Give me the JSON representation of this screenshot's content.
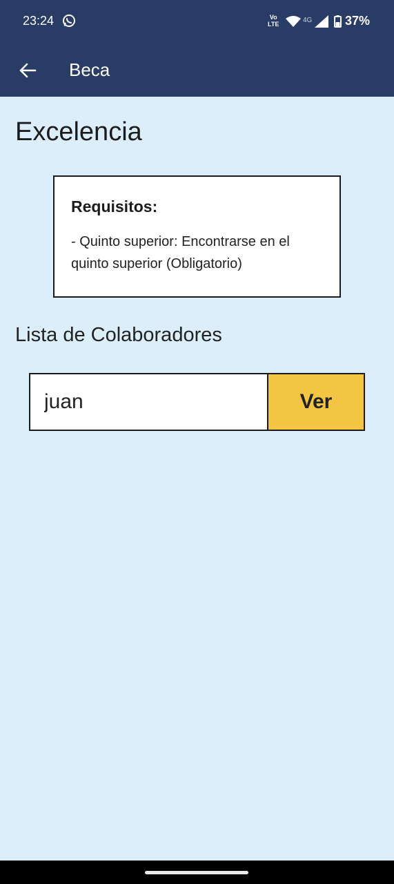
{
  "status_bar": {
    "time": "23:24",
    "volte_top": "Vo",
    "volte_bottom": "LTE",
    "network": "4G",
    "battery": "37%",
    "icons": [
      "whatsapp-icon",
      "wifi-icon",
      "signal-icon",
      "battery-icon"
    ]
  },
  "app_bar": {
    "title": "Beca",
    "back_icon": "arrow-left-icon",
    "color": "#283c66"
  },
  "page": {
    "heading": "Excelencia",
    "background": "#dbeefa"
  },
  "requirements": {
    "title": "Requisitos:",
    "text": "- Quinto superior: Encontrarse en el quinto superior (Obligatorio)"
  },
  "collaborators": {
    "label": "Lista de Colaboradores",
    "search_value": "juan",
    "button_label": "Ver",
    "button_color": "#f4c542"
  }
}
